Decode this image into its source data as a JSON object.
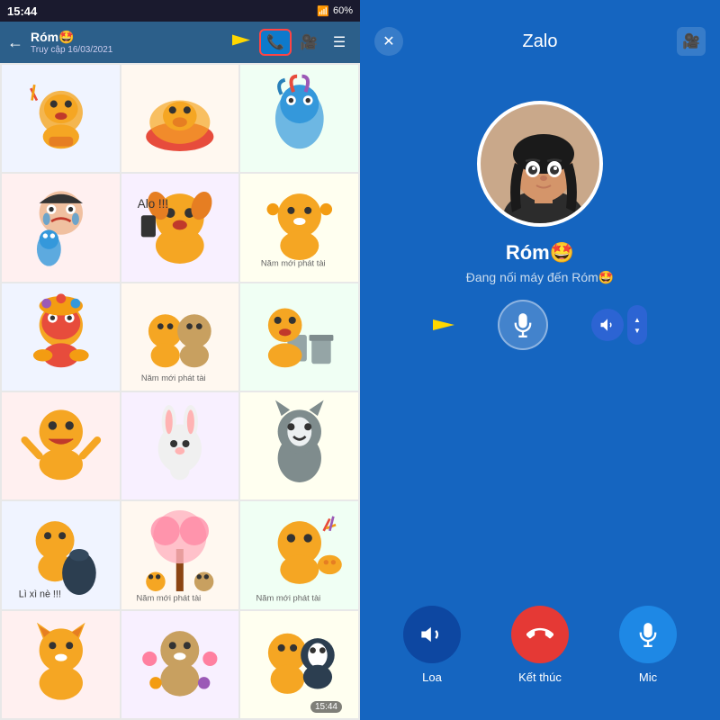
{
  "left": {
    "statusBar": {
      "time": "15:44",
      "battery": "60%",
      "signal": "Vd8"
    },
    "header": {
      "backLabel": "←",
      "contactName": "Róm🤩",
      "contactSub": "Truy cập 16/03/2021",
      "phoneIcon": "📞",
      "videoIcon": "🎥",
      "menuIcon": "☰"
    },
    "timestamp": "15:44",
    "stickers": [
      {
        "emoji": "🐕",
        "text": ""
      },
      {
        "emoji": "🦮",
        "text": ""
      },
      {
        "emoji": "🐟",
        "text": ""
      },
      {
        "emoji": "😭",
        "text": ""
      },
      {
        "emoji": "🐶",
        "text": "Alo !!!"
      },
      {
        "emoji": "🦊",
        "text": "Năm mới phát tài"
      },
      {
        "emoji": "🦊",
        "text": ""
      },
      {
        "emoji": "🦊",
        "text": "Năm mới phát tài"
      },
      {
        "emoji": "🎭",
        "text": ""
      },
      {
        "emoji": "🦊",
        "text": ""
      },
      {
        "emoji": "🐇",
        "text": ""
      },
      {
        "emoji": "🦮",
        "text": ""
      },
      {
        "emoji": "🦊",
        "text": "Lì xì nè !!!"
      },
      {
        "emoji": "🌸",
        "text": "Năm mới phát tài"
      },
      {
        "emoji": "🐕",
        "text": "Năm mới phát tài"
      },
      {
        "emoji": "🦊",
        "text": ""
      },
      {
        "emoji": "🦮",
        "text": ""
      },
      {
        "emoji": "🐩",
        "text": ""
      }
    ]
  },
  "right": {
    "appName": "Zalo",
    "callerName": "Róm🤩",
    "callStatus": "Đang nối máy đến Róm🤩",
    "controls": {
      "speaker": {
        "label": "Loa",
        "icon": "🔊"
      },
      "end": {
        "label": "Kết thúc",
        "icon": "📵"
      },
      "mic": {
        "label": "Mic",
        "icon": "🎤"
      }
    }
  }
}
